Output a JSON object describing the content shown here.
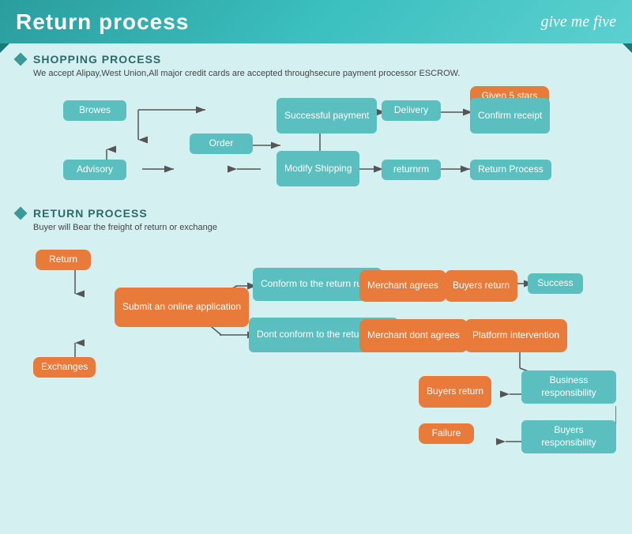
{
  "header": {
    "title": "Return process",
    "logo": "give me five"
  },
  "shopping_section": {
    "title": "SHOPPING PROCESS",
    "subtitle": "We accept Alipay,West Union,All major credit cards are accepted throughsecure payment processor ESCROW.",
    "boxes": {
      "browes": "Browes",
      "order": "Order",
      "advisory": "Advisory",
      "modify_shipping": "Modify\nShipping",
      "successful_payment": "Successful\npayment",
      "delivery": "Delivery",
      "confirm_receipt": "Confirm\nreceipt",
      "given_5_stars": "Given 5 stars",
      "returnrm": "returnrm",
      "return_process": "Return Process"
    }
  },
  "return_section": {
    "title": "RETURN PROCESS",
    "subtitle": "Buyer will Bear the freight of return or exchange",
    "boxes": {
      "return_btn": "Return",
      "exchanges": "Exchanges",
      "submit_online": "Submit an online\napplication",
      "conform_rules": "Conform to the\nreturn rules",
      "dont_conform_rules": "Dont conform to the\nreturn rules",
      "merchant_agrees": "Merchant\nagrees",
      "merchant_dont_agrees": "Merchant\ndont agrees",
      "buyers_return_1": "Buyers\nreturn",
      "buyers_return_2": "Buyers\nreturn",
      "success": "Success",
      "platform_intervention": "Platform\nintervention",
      "business_responsibility": "Business\nresponsibility",
      "buyers_responsibility": "Buyers\nresponsibility",
      "failure": "Failure"
    }
  }
}
